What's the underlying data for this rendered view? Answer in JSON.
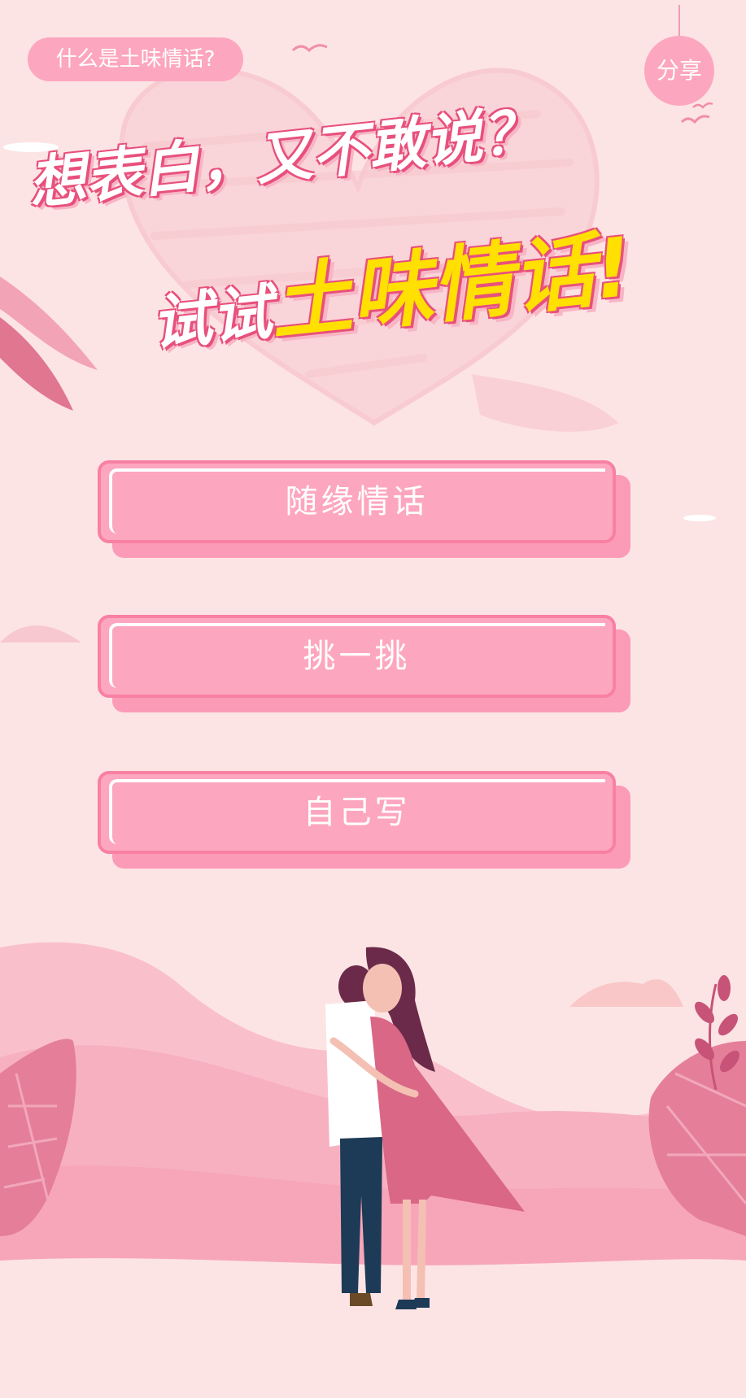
{
  "header": {
    "about_label": "什么是土味情话?",
    "share_label": "分享"
  },
  "headline": {
    "line1": "想表白，又不敢说？",
    "line2_prefix": "试试",
    "line2_highlight": "土味情话!"
  },
  "menu": {
    "items": [
      {
        "label": "随缘情话"
      },
      {
        "label": "挑一挑"
      },
      {
        "label": "自己写"
      }
    ]
  },
  "colors": {
    "background": "#fde4e4",
    "button": "#fda6bf",
    "button_border": "#f880a3",
    "highlight_text": "#ffe000",
    "outline": "#e8507c"
  },
  "icons": [
    "bird-icon",
    "heart-scribble",
    "leaf-icon",
    "couple-illustration"
  ]
}
